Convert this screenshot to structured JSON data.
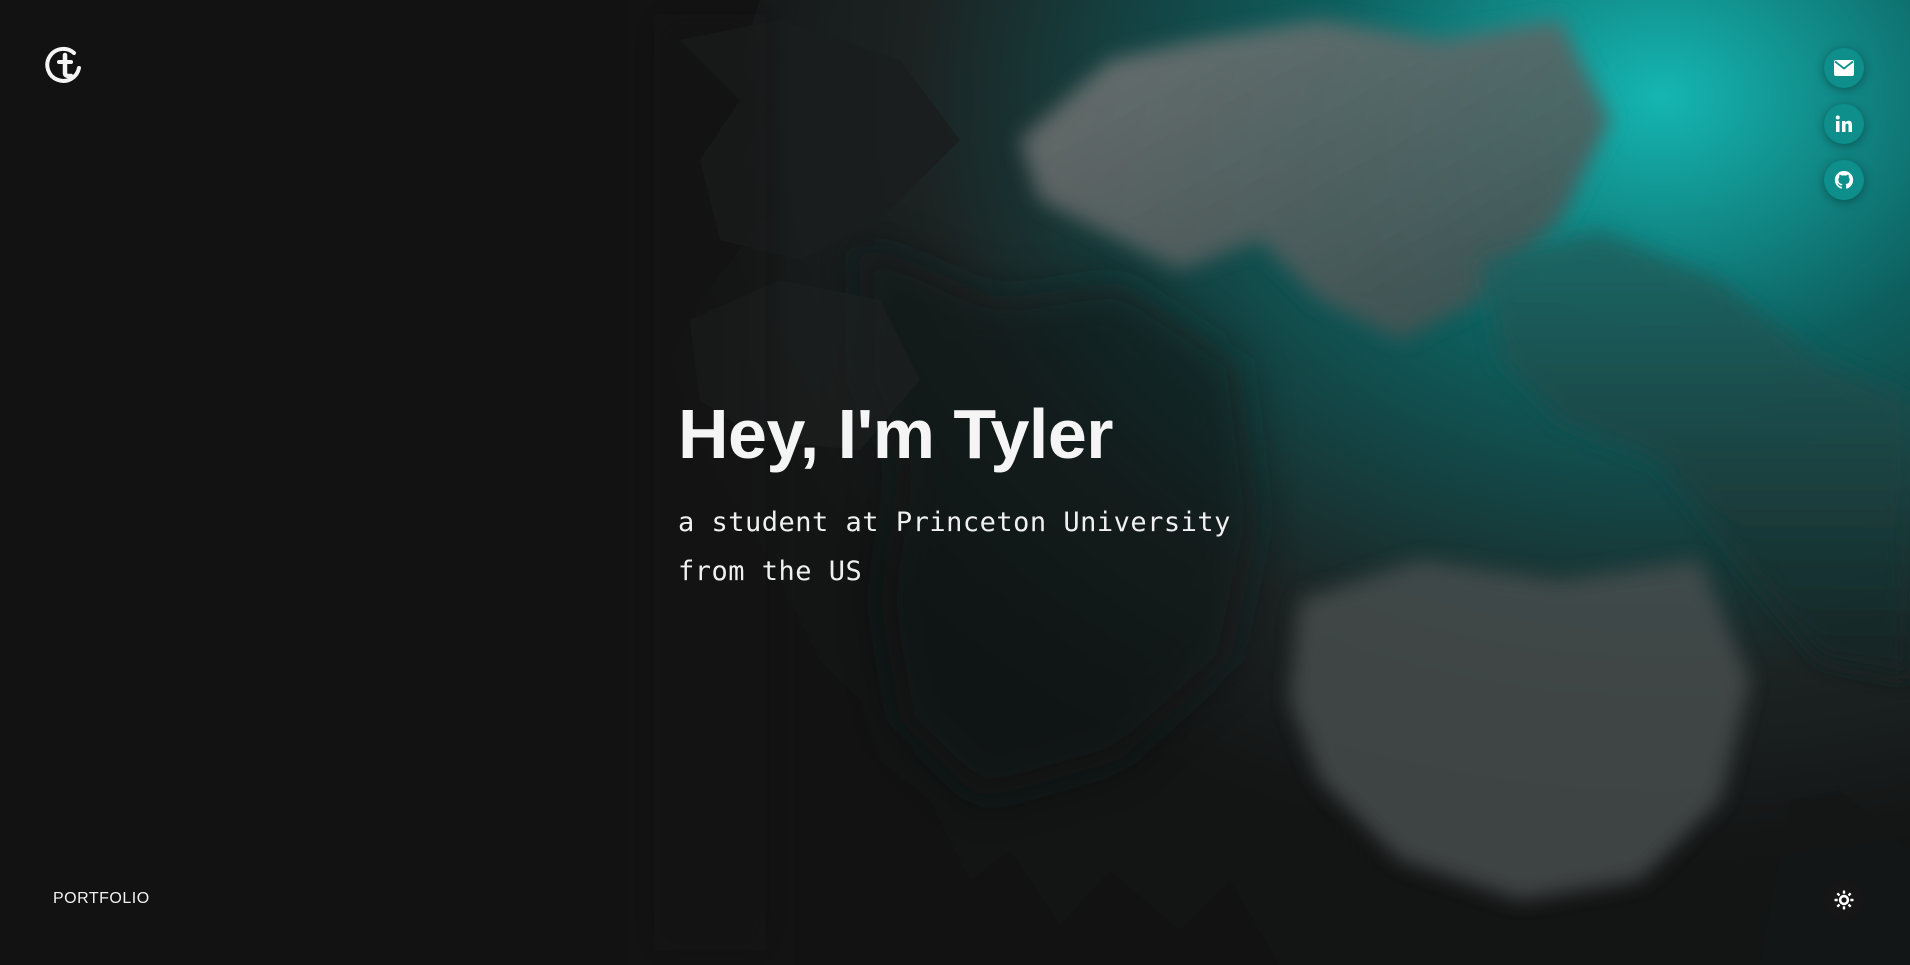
{
  "header": {
    "logo_letter": "t"
  },
  "hero": {
    "title": "Hey, I'm Tyler",
    "subtitle_line1": "a student at Princeton University",
    "subtitle_line2": "from the US"
  },
  "social": [
    {
      "icon": "mail-icon"
    },
    {
      "icon": "linkedin-icon",
      "text": "in"
    },
    {
      "icon": "github-icon"
    }
  ],
  "footer": {
    "portfolio_label": "PORTFOLIO",
    "theme_icon": "sun-icon"
  },
  "colors": {
    "background": "#121212",
    "accent": "#0e8f8c",
    "text": "#f2f2f2"
  }
}
